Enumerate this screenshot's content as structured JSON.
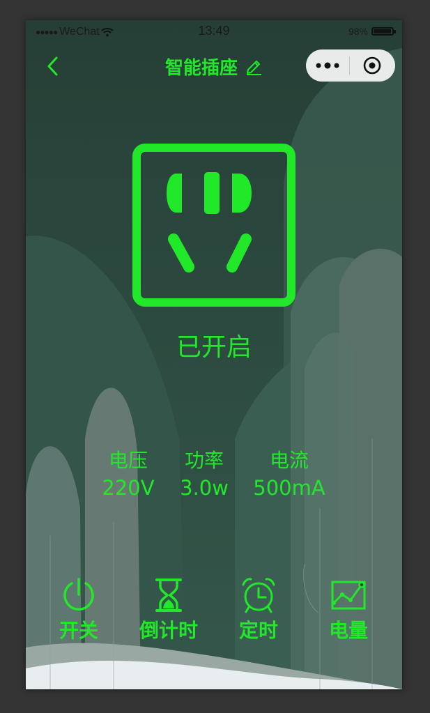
{
  "colors": {
    "accent": "#22e82a",
    "background": "#2c4a3f"
  },
  "status_bar": {
    "signal_dots": "●●●●●",
    "carrier": "WeChat",
    "time": "13:49",
    "battery_percent": "98%",
    "battery_level": 0.98
  },
  "nav": {
    "back_icon": "chevron-left-icon",
    "title": "智能插座",
    "edit_icon": "pencil-icon",
    "capsule_more_icon": "more-dots-icon",
    "capsule_close_icon": "target-close-icon"
  },
  "device": {
    "socket_icon": "power-socket-icon",
    "state": "已开启"
  },
  "metrics": [
    {
      "label": "电压",
      "value": "220V"
    },
    {
      "label": "功率",
      "value": "3.0w"
    },
    {
      "label": "电流",
      "value": "500mA"
    }
  ],
  "controls": [
    {
      "label": "开关",
      "icon": "power-icon"
    },
    {
      "label": "倒计时",
      "icon": "hourglass-icon"
    },
    {
      "label": "定时",
      "icon": "alarm-clock-icon"
    },
    {
      "label": "电量",
      "icon": "line-chart-icon"
    }
  ]
}
